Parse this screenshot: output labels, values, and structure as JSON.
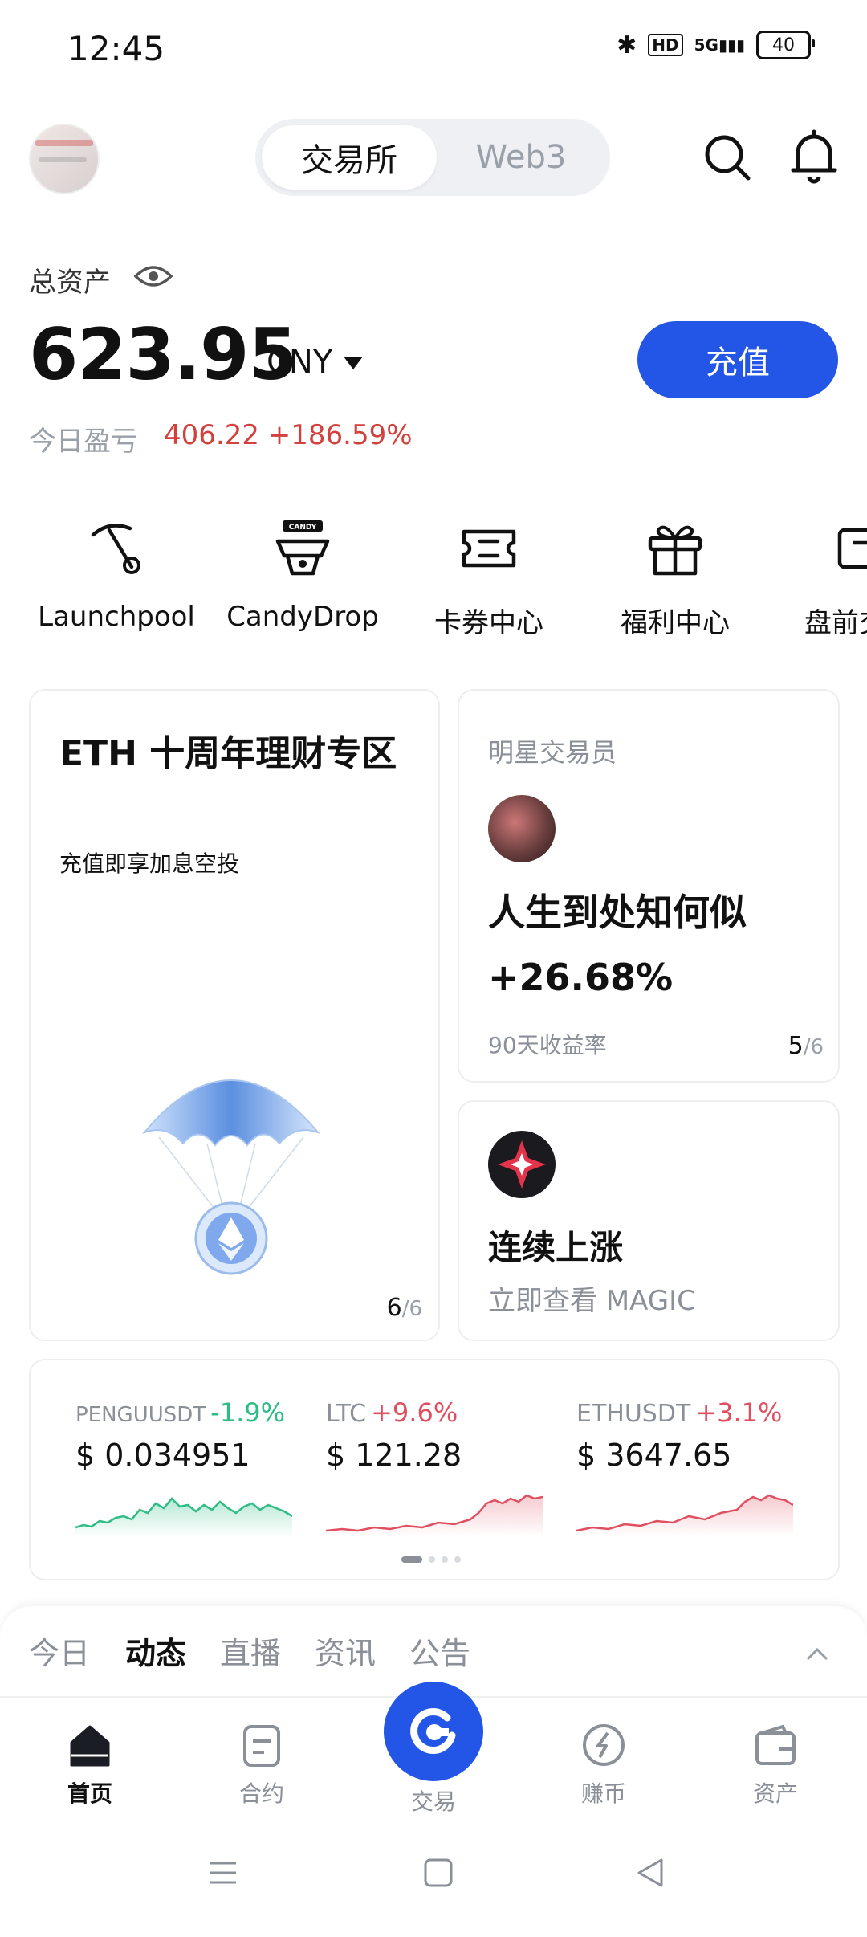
{
  "status_bar": {
    "time": "12:45",
    "battery": "40",
    "network": "5G",
    "hd": "HD"
  },
  "header": {
    "tabs": [
      "交易所",
      "Web3"
    ],
    "active_tab": "交易所"
  },
  "assets": {
    "label": "总资产",
    "amount": "623.95",
    "unit": "CNY",
    "deposit_label": "充值",
    "pnl_label": "今日盈亏",
    "pnl_value": "406.22 +186.59%"
  },
  "quick_actions": [
    {
      "label": "Launchpool",
      "icon": "pickaxe-icon"
    },
    {
      "label": "CandyDrop",
      "icon": "candy-icon"
    },
    {
      "label": "卡券中心",
      "icon": "ticket-icon"
    },
    {
      "label": "福利中心",
      "icon": "gift-icon"
    },
    {
      "label": "盘前交",
      "icon": "premarket-icon"
    }
  ],
  "eth_card": {
    "title": "ETH 十周年理财专区",
    "subtitle": "充值即享加息空投",
    "page": "6",
    "total": "/6"
  },
  "trader_card": {
    "label": "明星交易员",
    "name": "人生到处知何似",
    "return": "+26.68%",
    "return_label": "90天收益率",
    "page": "5",
    "total": "/6"
  },
  "magic_card": {
    "title": "连续上涨",
    "subtitle": "立即查看 MAGIC"
  },
  "tickers": [
    {
      "symbol": "PENGUUSDT",
      "change": "-1.9%",
      "price": "$ 0.034951",
      "color": "#2ebd85"
    },
    {
      "symbol": "LTC",
      "change": "+9.6%",
      "price": "$ 121.28",
      "color": "#e04f5f"
    },
    {
      "symbol": "ETHUSDT",
      "change": "+3.1%",
      "price": "$ 3647.65",
      "color": "#e04f5f"
    }
  ],
  "feed_tabs": [
    "今日",
    "动态",
    "直播",
    "资讯",
    "公告"
  ],
  "feed_active": "动态",
  "nav": [
    {
      "label": "首页",
      "icon": "home-icon",
      "active": true
    },
    {
      "label": "合约",
      "icon": "contract-icon",
      "active": false
    },
    {
      "label": "交易",
      "icon": "trade-icon",
      "active": false
    },
    {
      "label": "赚币",
      "icon": "earn-icon",
      "active": false
    },
    {
      "label": "资产",
      "icon": "wallet-icon",
      "active": false
    }
  ],
  "colors": {
    "accent": "#2356e6",
    "up": "#e04f5f",
    "down": "#2ebd85",
    "loss_text": "#d2413e"
  }
}
